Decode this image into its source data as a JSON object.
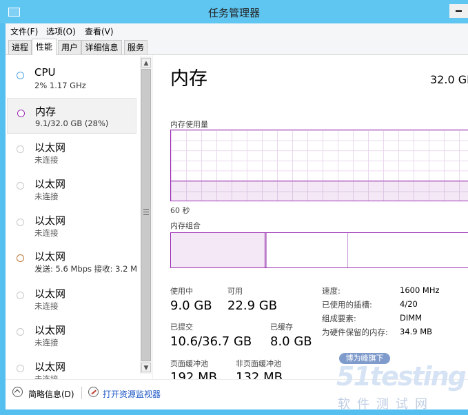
{
  "window": {
    "title": "任务管理器"
  },
  "menu": [
    {
      "label": "文件(F)"
    },
    {
      "label": "选项(O)"
    },
    {
      "label": "查看(V)"
    }
  ],
  "tabs": [
    {
      "label": "进程",
      "active": false
    },
    {
      "label": "性能",
      "active": true
    },
    {
      "label": "用户",
      "active": false
    },
    {
      "label": "详细信息",
      "active": false
    },
    {
      "label": "服务",
      "active": false
    }
  ],
  "sidebar": {
    "items": [
      {
        "name": "CPU",
        "sub": "2% 1.17 GHz",
        "color": "#4fa3e0"
      },
      {
        "name": "内存",
        "sub": "9.1/32.0 GB (28%)",
        "color": "#9b2bb3",
        "selected": true
      },
      {
        "name": "以太网",
        "sub": "未连接",
        "color": "#c8c8c8"
      },
      {
        "name": "以太网",
        "sub": "未连接",
        "color": "#c8c8c8"
      },
      {
        "name": "以太网",
        "sub": "未连接",
        "color": "#c8c8c8"
      },
      {
        "name": "以太网",
        "sub": "发送: 5.6 Mbps 接收: 3.2 M",
        "color": "#c0763a"
      },
      {
        "name": "以太网",
        "sub": "未连接",
        "color": "#c8c8c8"
      },
      {
        "name": "以太网",
        "sub": "未连接",
        "color": "#c8c8c8"
      },
      {
        "name": "以太网",
        "sub": "未连接",
        "color": "#c8c8c8"
      }
    ]
  },
  "memory": {
    "title": "内存",
    "total": "32.0 GB",
    "usage_label": "内存使用量",
    "usage_fraction": 0.28,
    "time_label": "60 秒",
    "composition_label": "内存组合",
    "accent_color": "#9b2bb3",
    "stats": {
      "in_use_label": "使用中",
      "in_use": "9.0 GB",
      "available_label": "可用",
      "available": "22.9 GB",
      "committed_label": "已提交",
      "committed": "10.6/36.7 GB",
      "cached_label": "已缓存",
      "cached": "8.0 GB",
      "paged_label": "页面缓冲池",
      "paged": "192 MB",
      "nonpaged_label": "非页面缓冲池",
      "nonpaged": "132 MB"
    },
    "details": [
      {
        "label": "速度:",
        "value": "1600 MHz"
      },
      {
        "label": "已使用的插槽:",
        "value": "4/20"
      },
      {
        "label": "组成要素:",
        "value": "DIMM"
      },
      {
        "label": "为硬件保留的内存:",
        "value": "34.9 MB"
      }
    ]
  },
  "footer": {
    "fewer_details": "简略信息(D)",
    "open_monitor": "打开资源监视器"
  },
  "watermark": {
    "badge": "博为峰旗下",
    "logo": "51testing",
    "sub": "软件测试网"
  }
}
